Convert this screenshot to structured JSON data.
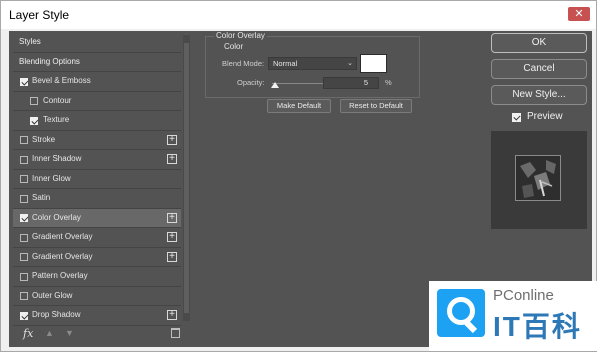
{
  "window": {
    "title": "Layer Style",
    "close_glyph": "✕"
  },
  "sidebar": {
    "items": [
      {
        "label": "Styles",
        "type": "header",
        "checked": null,
        "plus": false,
        "indent": false,
        "selected": false
      },
      {
        "label": "Blending Options",
        "type": "header",
        "checked": null,
        "plus": false,
        "indent": false,
        "selected": false
      },
      {
        "label": "Bevel & Emboss",
        "type": "cb",
        "checked": true,
        "plus": false,
        "indent": false,
        "selected": false
      },
      {
        "label": "Contour",
        "type": "cb",
        "checked": false,
        "plus": false,
        "indent": true,
        "selected": false
      },
      {
        "label": "Texture",
        "type": "cb",
        "checked": true,
        "plus": false,
        "indent": true,
        "selected": false
      },
      {
        "label": "Stroke",
        "type": "cb",
        "checked": false,
        "plus": true,
        "indent": false,
        "selected": false
      },
      {
        "label": "Inner Shadow",
        "type": "cb",
        "checked": false,
        "plus": true,
        "indent": false,
        "selected": false
      },
      {
        "label": "Inner Glow",
        "type": "cb",
        "checked": false,
        "plus": false,
        "indent": false,
        "selected": false
      },
      {
        "label": "Satin",
        "type": "cb",
        "checked": false,
        "plus": false,
        "indent": false,
        "selected": false
      },
      {
        "label": "Color Overlay",
        "type": "cb",
        "checked": true,
        "plus": true,
        "indent": false,
        "selected": true
      },
      {
        "label": "Gradient Overlay",
        "type": "cb",
        "checked": false,
        "plus": true,
        "indent": false,
        "selected": false
      },
      {
        "label": "Gradient Overlay",
        "type": "cb",
        "checked": false,
        "plus": true,
        "indent": false,
        "selected": false
      },
      {
        "label": "Pattern Overlay",
        "type": "cb",
        "checked": false,
        "plus": false,
        "indent": false,
        "selected": false
      },
      {
        "label": "Outer Glow",
        "type": "cb",
        "checked": false,
        "plus": false,
        "indent": false,
        "selected": false
      },
      {
        "label": "Drop Shadow",
        "type": "cb",
        "checked": true,
        "plus": true,
        "indent": false,
        "selected": false
      }
    ],
    "fx_label": "fx",
    "plus_glyph": "+",
    "up_glyph": "▲",
    "down_glyph": "▼"
  },
  "color_overlay": {
    "group_title": "Color Overlay",
    "sub_title": "Color",
    "blend_mode_label": "Blend Mode:",
    "blend_mode_value": "Normal",
    "caret": "⌄",
    "opacity_label": "Opacity:",
    "opacity_value": "5",
    "opacity_unit": "%",
    "make_default": "Make Default",
    "reset_default": "Reset to Default",
    "swatch_color": "#ffffff"
  },
  "actions": {
    "ok": "OK",
    "cancel": "Cancel",
    "new_style": "New Style...",
    "preview_label": "Preview",
    "preview_checked": true
  },
  "watermark": {
    "line1": "PConline",
    "line2": "IT百科"
  }
}
